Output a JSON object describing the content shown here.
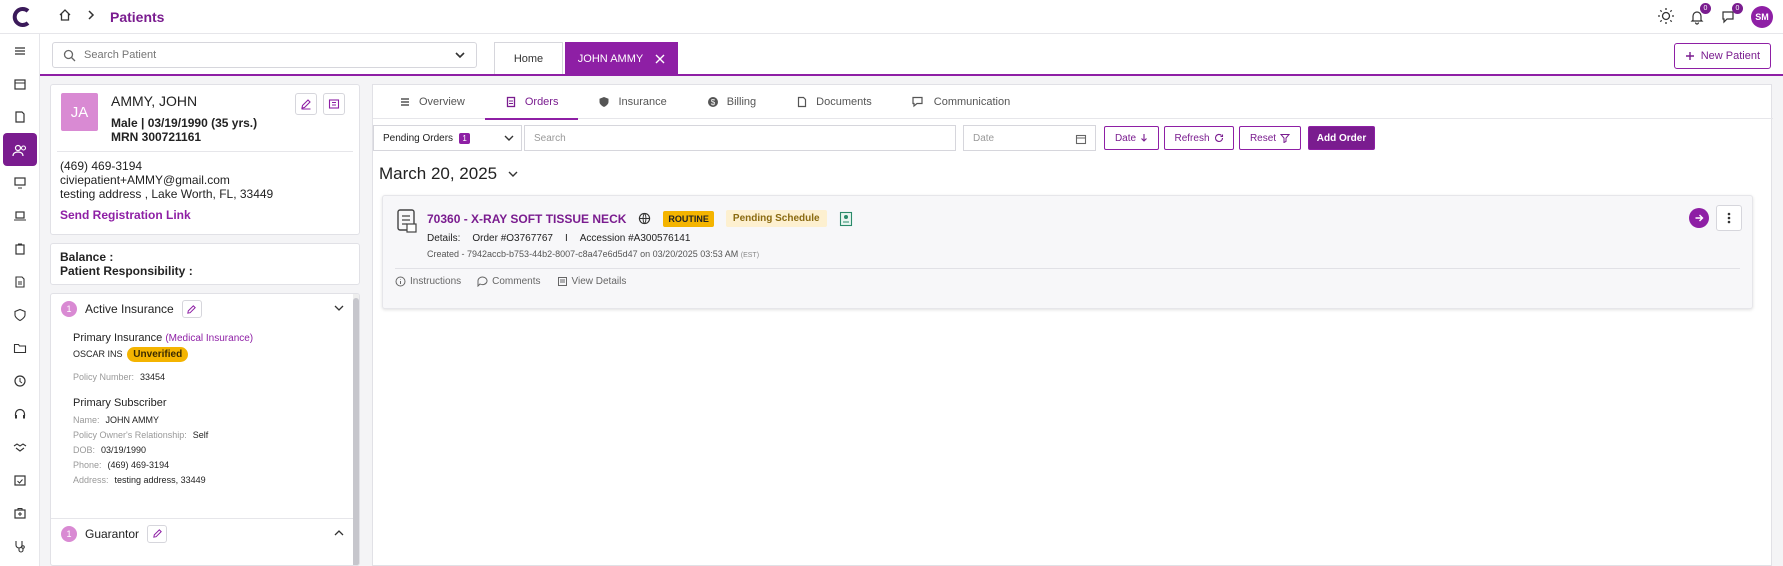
{
  "header": {
    "page_title": "Patients",
    "notifications_count": "0",
    "messages_count": "0",
    "user_initials": "SM"
  },
  "search": {
    "placeholder": "Search Patient"
  },
  "tabs": {
    "home": "Home",
    "patient": "JOHN AMMY"
  },
  "new_patient_label": "New Patient",
  "patient": {
    "initials": "JA",
    "name": "AMMY, JOHN",
    "demographics": "Male | 03/19/1990 (35 yrs.)",
    "mrn": "MRN 300721161",
    "phone": "(469) 469-3194",
    "email": "civiepatient+AMMY@gmail.com",
    "address": "testing address , Lake Worth, FL, 33449",
    "registration_link": "Send Registration Link",
    "balance_label": "Balance :",
    "responsibility_label": "Patient Responsibility :"
  },
  "insurance": {
    "count": "1",
    "title": "Active Insurance",
    "primary_label": "Primary Insurance",
    "primary_type": "(Medical Insurance)",
    "payer": "OSCAR INS",
    "status": "Unverified",
    "policy_label": "Policy Number:",
    "policy_number": "33454",
    "subscriber_title": "Primary Subscriber",
    "name_label": "Name:",
    "name": "JOHN AMMY",
    "relationship_label": "Policy Owner's Relationship:",
    "relationship": "Self",
    "dob_label": "DOB:",
    "dob": "03/19/1990",
    "phone_label": "Phone:",
    "phone": "(469) 469-3194",
    "address_label": "Address:",
    "address": "testing address, 33449"
  },
  "guarantor": {
    "count": "1",
    "title": "Guarantor"
  },
  "subtabs": [
    "Overview",
    "Orders",
    "Insurance",
    "Billing",
    "Documents",
    "Communication"
  ],
  "filters": {
    "pending_label": "Pending Orders",
    "pending_count": "1",
    "search_placeholder": "Search",
    "date_placeholder": "Date",
    "date_sort": "Date",
    "refresh": "Refresh",
    "reset": "Reset",
    "add_order": "Add Order"
  },
  "date_heading": "March 20, 2025",
  "order": {
    "title": "70360 - X-RAY SOFT TISSUE NECK",
    "priority": "ROUTINE",
    "status": "Pending Schedule",
    "details_label": "Details:",
    "order_number": "Order #O3767767",
    "separator": "I",
    "accession": "Accession #A300576141",
    "created": "Created - 7942accb-b753-44b2-8007-c8a47e6d5d47 on 03/20/2025 03:53 AM",
    "timezone": "(EST)",
    "instructions": "Instructions",
    "comments": "Comments",
    "view_details": "View Details"
  },
  "colors": {
    "accent": "#8e1fa5",
    "accent_dark": "#7a1c8f",
    "warning": "#f4b400"
  }
}
